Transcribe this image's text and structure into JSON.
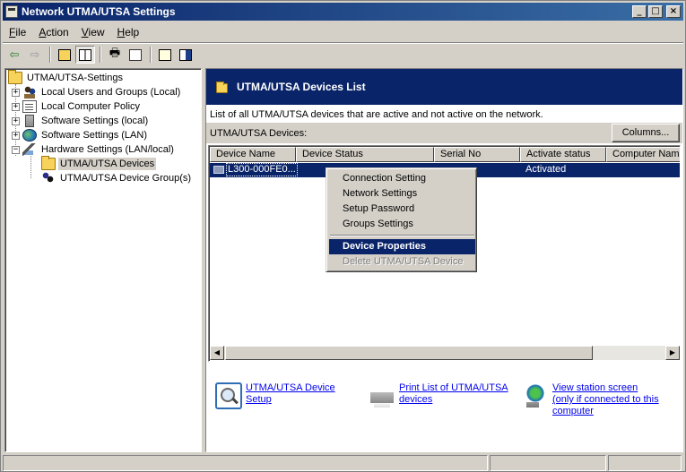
{
  "window": {
    "title": "Network UTMA/UTSA Settings"
  },
  "menu": {
    "items": [
      {
        "label": "File",
        "accel": "F",
        "rest": "ile"
      },
      {
        "label": "Action",
        "accel": "A",
        "rest": "ction"
      },
      {
        "label": "View",
        "accel": "V",
        "rest": "iew"
      },
      {
        "label": "Help",
        "accel": "H",
        "rest": "elp"
      }
    ]
  },
  "toolbar": {
    "icons": [
      "back-arrow-icon",
      "forward-arrow-icon",
      "up-folder-icon",
      "show-hide-tree-icon",
      "print-icon",
      "refresh-icon",
      "help-icon",
      "properties-icon"
    ]
  },
  "tree": {
    "root": "UTMA/UTSA-Settings",
    "items": [
      {
        "label": "Local Users and Groups (Local)",
        "expander": "+"
      },
      {
        "label": "Local Computer Policy",
        "expander": "+"
      },
      {
        "label": "Software Settings (local)",
        "expander": "+"
      },
      {
        "label": "Software Settings (LAN)",
        "expander": "+"
      },
      {
        "label": "Hardware Settings (LAN/local)",
        "expander": "−"
      }
    ],
    "children": [
      {
        "label": "UTMA/UTSA Devices",
        "selected": true
      },
      {
        "label": "UTMA/UTSA Device Group(s)"
      }
    ]
  },
  "right": {
    "header_title": "UTMA/UTSA Devices List",
    "description": "List of all UTMA/UTSA devices that are active and not active on the network.",
    "devices_label": "UTMA/UTSA Devices:",
    "columns_button": "Columns...",
    "columns": [
      "Device Name",
      "Device Status",
      "Serial No",
      "Activate status",
      "Computer Name"
    ],
    "rows": [
      {
        "device_name": "L300-000FE0...",
        "activate_status": "Activated"
      }
    ]
  },
  "context_menu": {
    "items": [
      {
        "label": "Connection Setting"
      },
      {
        "label": "Network Settings"
      },
      {
        "label": "Setup Password"
      },
      {
        "label": "Groups Settings"
      },
      {
        "label": "Device Properties",
        "highlighted": true
      },
      {
        "label": "Delete UTMA/UTSA Device",
        "disabled": true
      }
    ]
  },
  "tasks": {
    "setup_line1": "UTMA/UTSA Device",
    "setup_line2": "Setup",
    "print_line1": "Print List of UTMA/UTSA",
    "print_line2": "devices",
    "station_line1": "View station screen",
    "station_line2": "(only if connected to this",
    "station_line3": "computer"
  },
  "colors": {
    "title_bar": "#0a246a",
    "selection": "#0a246a",
    "face": "#d4d0c8",
    "link": "#0000ee"
  }
}
